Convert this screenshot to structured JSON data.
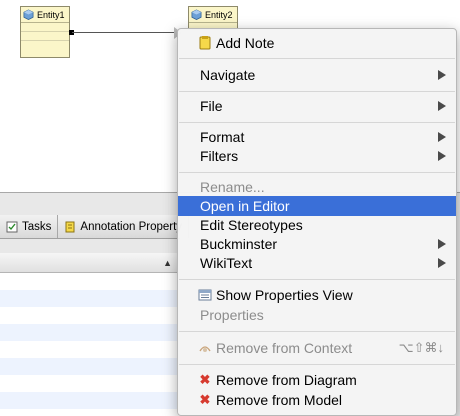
{
  "diagram": {
    "entity1": {
      "name": "Entity1"
    },
    "entity2": {
      "name": "Entity2"
    }
  },
  "panel": {
    "tabs": [
      {
        "label": "Tasks",
        "icon": "tasks-icon"
      },
      {
        "label": "Annotation Property",
        "icon": "annotation-icon"
      }
    ],
    "sort_indicator": "▲"
  },
  "menu": {
    "items": [
      {
        "label": "Add Note",
        "icon": "note-icon",
        "enabled": true
      },
      {
        "label": "Navigate",
        "submenu": true,
        "enabled": true
      },
      {
        "label": "File",
        "submenu": true,
        "enabled": true
      },
      {
        "label": "Format",
        "submenu": true,
        "enabled": true
      },
      {
        "label": "Filters",
        "submenu": true,
        "enabled": true
      },
      {
        "label": "Rename...",
        "enabled": false
      },
      {
        "label": "Open in Editor",
        "enabled": true,
        "selected": true
      },
      {
        "label": "Edit Stereotypes",
        "enabled": true
      },
      {
        "label": "Buckminster",
        "submenu": true,
        "enabled": true
      },
      {
        "label": "WikiText",
        "submenu": true,
        "enabled": true
      },
      {
        "label": "Show Properties View",
        "icon": "properties-view-icon",
        "enabled": true
      },
      {
        "label": "Properties",
        "enabled": false
      },
      {
        "label": "Remove from Context",
        "icon": "remove-context-icon",
        "enabled": false,
        "shortcut": "⌥⇧⌘↓"
      },
      {
        "label": "Remove from Diagram",
        "icon": "delete-x-icon",
        "enabled": true
      },
      {
        "label": "Remove from Model",
        "icon": "delete-x-icon",
        "enabled": true
      }
    ]
  },
  "colors": {
    "selection": "#3a6fd8",
    "entity_fill": "#fbf6c9",
    "delete_red": "#d63a2f"
  }
}
